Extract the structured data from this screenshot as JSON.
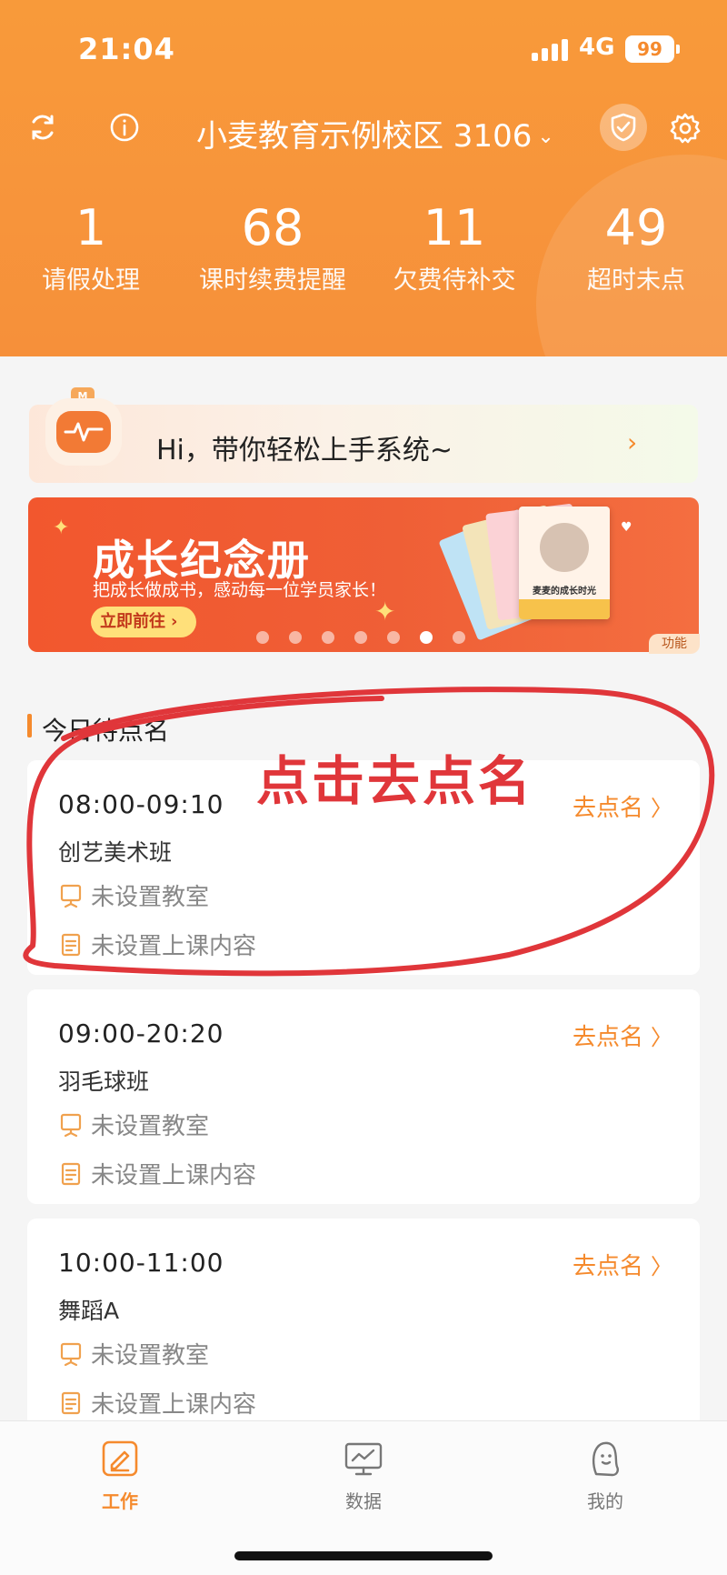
{
  "status_bar": {
    "time": "21:04",
    "network": "4G",
    "battery": "99"
  },
  "header": {
    "campus_name": "小麦教育示例校区 3106",
    "stats": [
      {
        "value": "1",
        "label": "请假处理"
      },
      {
        "value": "68",
        "label": "课时续费提醒"
      },
      {
        "value": "11",
        "label": "欠费待补交"
      },
      {
        "value": "49",
        "label": "超时未点"
      }
    ]
  },
  "guide": {
    "text": "Hi，带你轻松上手系统~",
    "arrow": "›"
  },
  "banner": {
    "title": "成长纪念册",
    "subtitle": "把成长做成书，感动每一位学员家长！",
    "button": "立即前往",
    "tag": "功能",
    "book_text": "麦麦的成长时光",
    "dots_total": 7,
    "dots_active_index": 5
  },
  "section": {
    "title": "今日待点名"
  },
  "annotation": {
    "text": "点击去点名",
    "color": "#e0363a"
  },
  "classes": [
    {
      "time": "08:00-09:10",
      "name": "创艺美术班",
      "room": "未设置教室",
      "content": "未设置上课内容",
      "action": "去点名"
    },
    {
      "time": "09:00-20:20",
      "name": "羽毛球班",
      "room": "未设置教室",
      "content": "未设置上课内容",
      "action": "去点名"
    },
    {
      "time": "10:00-11:00",
      "name": "舞蹈A",
      "room": "未设置教室",
      "content": "未设置上课内容",
      "action": "去点名"
    }
  ],
  "tabs": [
    {
      "label": "工作",
      "icon": "work-icon",
      "active": true
    },
    {
      "label": "数据",
      "icon": "data-icon",
      "active": false
    },
    {
      "label": "我的",
      "icon": "profile-icon",
      "active": false
    }
  ],
  "colors": {
    "accent": "#f58a2d",
    "header": "#f7943b",
    "banner": "#ef5f36"
  }
}
